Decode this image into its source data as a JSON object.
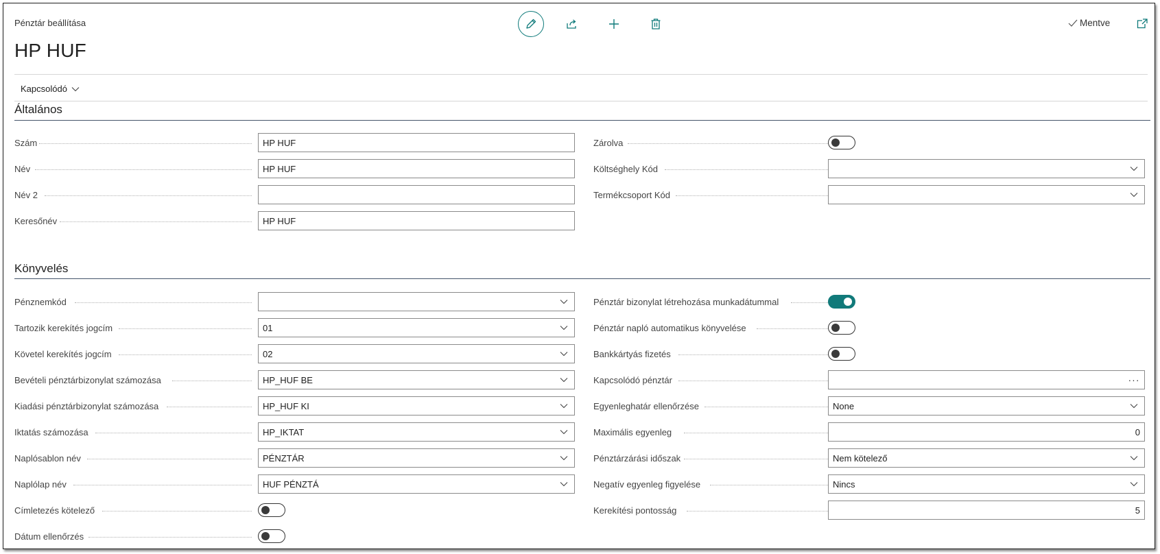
{
  "header": {
    "breadcrumb": "Pénztár beállítása",
    "title": "HP HUF",
    "saved_label": "Mentve",
    "related_label": "Kapcsolódó"
  },
  "toolbar": [
    "edit-icon",
    "share-icon",
    "add-icon",
    "delete-icon"
  ],
  "general": {
    "section_title": "Általános",
    "szam_label": "Szám",
    "szam_value": "HP HUF",
    "nev_label": "Név",
    "nev_value": "HP HUF",
    "nev2_label": "Név 2",
    "nev2_value": "",
    "keresonev_label": "Keresőnév",
    "keresonev_value": "HP HUF",
    "zarolva_label": "Zárolva",
    "zarolva_on": false,
    "koltseghely_label": "Költséghely Kód",
    "koltseghely_value": "",
    "termekcsoport_label": "Termékcsoport Kód",
    "termekcsoport_value": ""
  },
  "posting": {
    "section_title": "Könyvelés",
    "penznemkod_label": "Pénznemkód",
    "penznemkod_value": "",
    "tartozik_label": "Tartozik kerekítés jogcím",
    "tartozik_value": "01",
    "kovetel_label": "Követel kerekítés jogcím",
    "kovetel_value": "02",
    "beveteli_label": "Bevételi pénztárbizonylat számozása",
    "beveteli_value": "HP_HUF BE",
    "kiadasi_label": "Kiadási pénztárbizonylat számozása",
    "kiadasi_value": "HP_HUF KI",
    "iktatas_label": "Iktatás számozása",
    "iktatas_value": "HP_IKTAT",
    "naplosablon_label": "Naplósablon név",
    "naplosablon_value": "PÉNZTÁR",
    "naplolap_label": "Naplólap név",
    "naplolap_value": "HUF PÉNZTÁ",
    "cimletezes_label": "Címletezés kötelező",
    "cimletezes_on": false,
    "datum_label": "Dátum ellenőrzés",
    "datum_on": false,
    "munkadatum_label": "Pénztár bizonylat létrehozása munkadátummal",
    "munkadatum_on": true,
    "autokonyv_label": "Pénztár napló automatikus könyvelése",
    "autokonyv_on": false,
    "bankkartya_label": "Bankkártyás fizetés",
    "bankkartya_on": false,
    "kapcsolodo_label": "Kapcsolódó pénztár",
    "kapcsolodo_value": "",
    "kapcsolodo_ellipsis": "···",
    "egyenleghatar_label": "Egyenleghatár ellenőrzése",
    "egyenleghatar_value": "None",
    "maxegyenleg_label": "Maximális egyenleg",
    "maxegyenleg_value": "0",
    "zarasi_label": "Pénztárzárási időszak",
    "zarasi_value": "Nem kötelező",
    "negativ_label": "Negatív egyenleg figyelése",
    "negativ_value": "Nincs",
    "kerekitesi_label": "Kerekítési pontosság",
    "kerekitesi_value": "5"
  },
  "colors": {
    "accent": "#117a7a",
    "section_line": "#44546a"
  }
}
